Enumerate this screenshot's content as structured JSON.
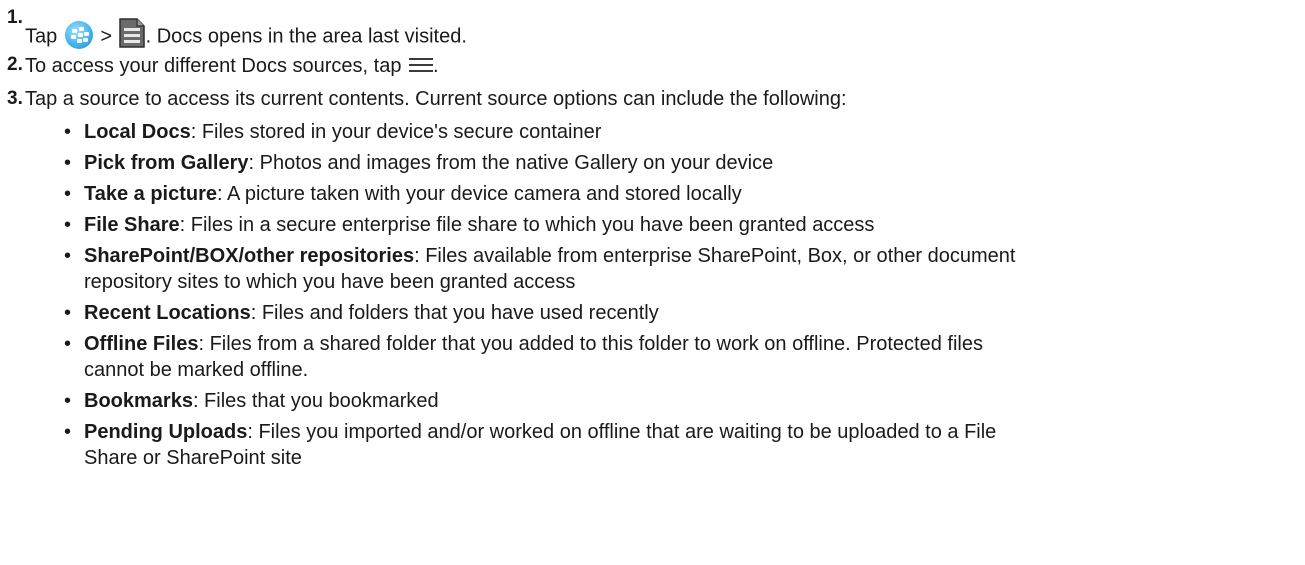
{
  "steps": [
    {
      "number": "1.",
      "text_before": "Tap",
      "separator": ">",
      "text_after": ". Docs opens in the area last visited.",
      "icons": [
        "blackberry-launcher-icon",
        "docs-icon"
      ]
    },
    {
      "number": "2.",
      "text_before": "To access your different Docs sources, tap",
      "text_after": ".",
      "icons": [
        "hamburger-menu-icon"
      ]
    },
    {
      "number": "3.",
      "text": "Tap a source to access its current contents. Current source options can include the following:"
    }
  ],
  "bullet_char": "•",
  "sources": [
    {
      "name": "Local Docs",
      "desc": ": Files stored in your device's secure container"
    },
    {
      "name": "Pick from Gallery",
      "desc": ": Photos and images from the native Gallery on your device"
    },
    {
      "name": "Take a picture",
      "desc": ": A picture taken with your device camera and stored locally"
    },
    {
      "name": "File Share",
      "desc": ": Files in a secure enterprise file share to which you have been granted access"
    },
    {
      "name": "SharePoint/BOX/other repositories",
      "desc": ": Files available from enterprise SharePoint, Box, or other document",
      "desc2": "repository sites to which you have been granted access"
    },
    {
      "name": "Recent Locations",
      "desc": ": Files and folders that you have used recently"
    },
    {
      "name": "Offline Files",
      "desc": ": Files from a shared folder that you added to this folder to work on offline. Protected files",
      "desc2": "cannot be marked offline."
    },
    {
      "name": "Bookmarks",
      "desc": ": Files that you bookmarked"
    },
    {
      "name": "Pending Uploads",
      "desc": ": Files you imported and/or worked on offline that are waiting to be uploaded to a File",
      "desc2": "Share or SharePoint site"
    }
  ],
  "colors": {
    "text": "#1a1a1a",
    "blackberry_icon": "#45b4ea"
  }
}
